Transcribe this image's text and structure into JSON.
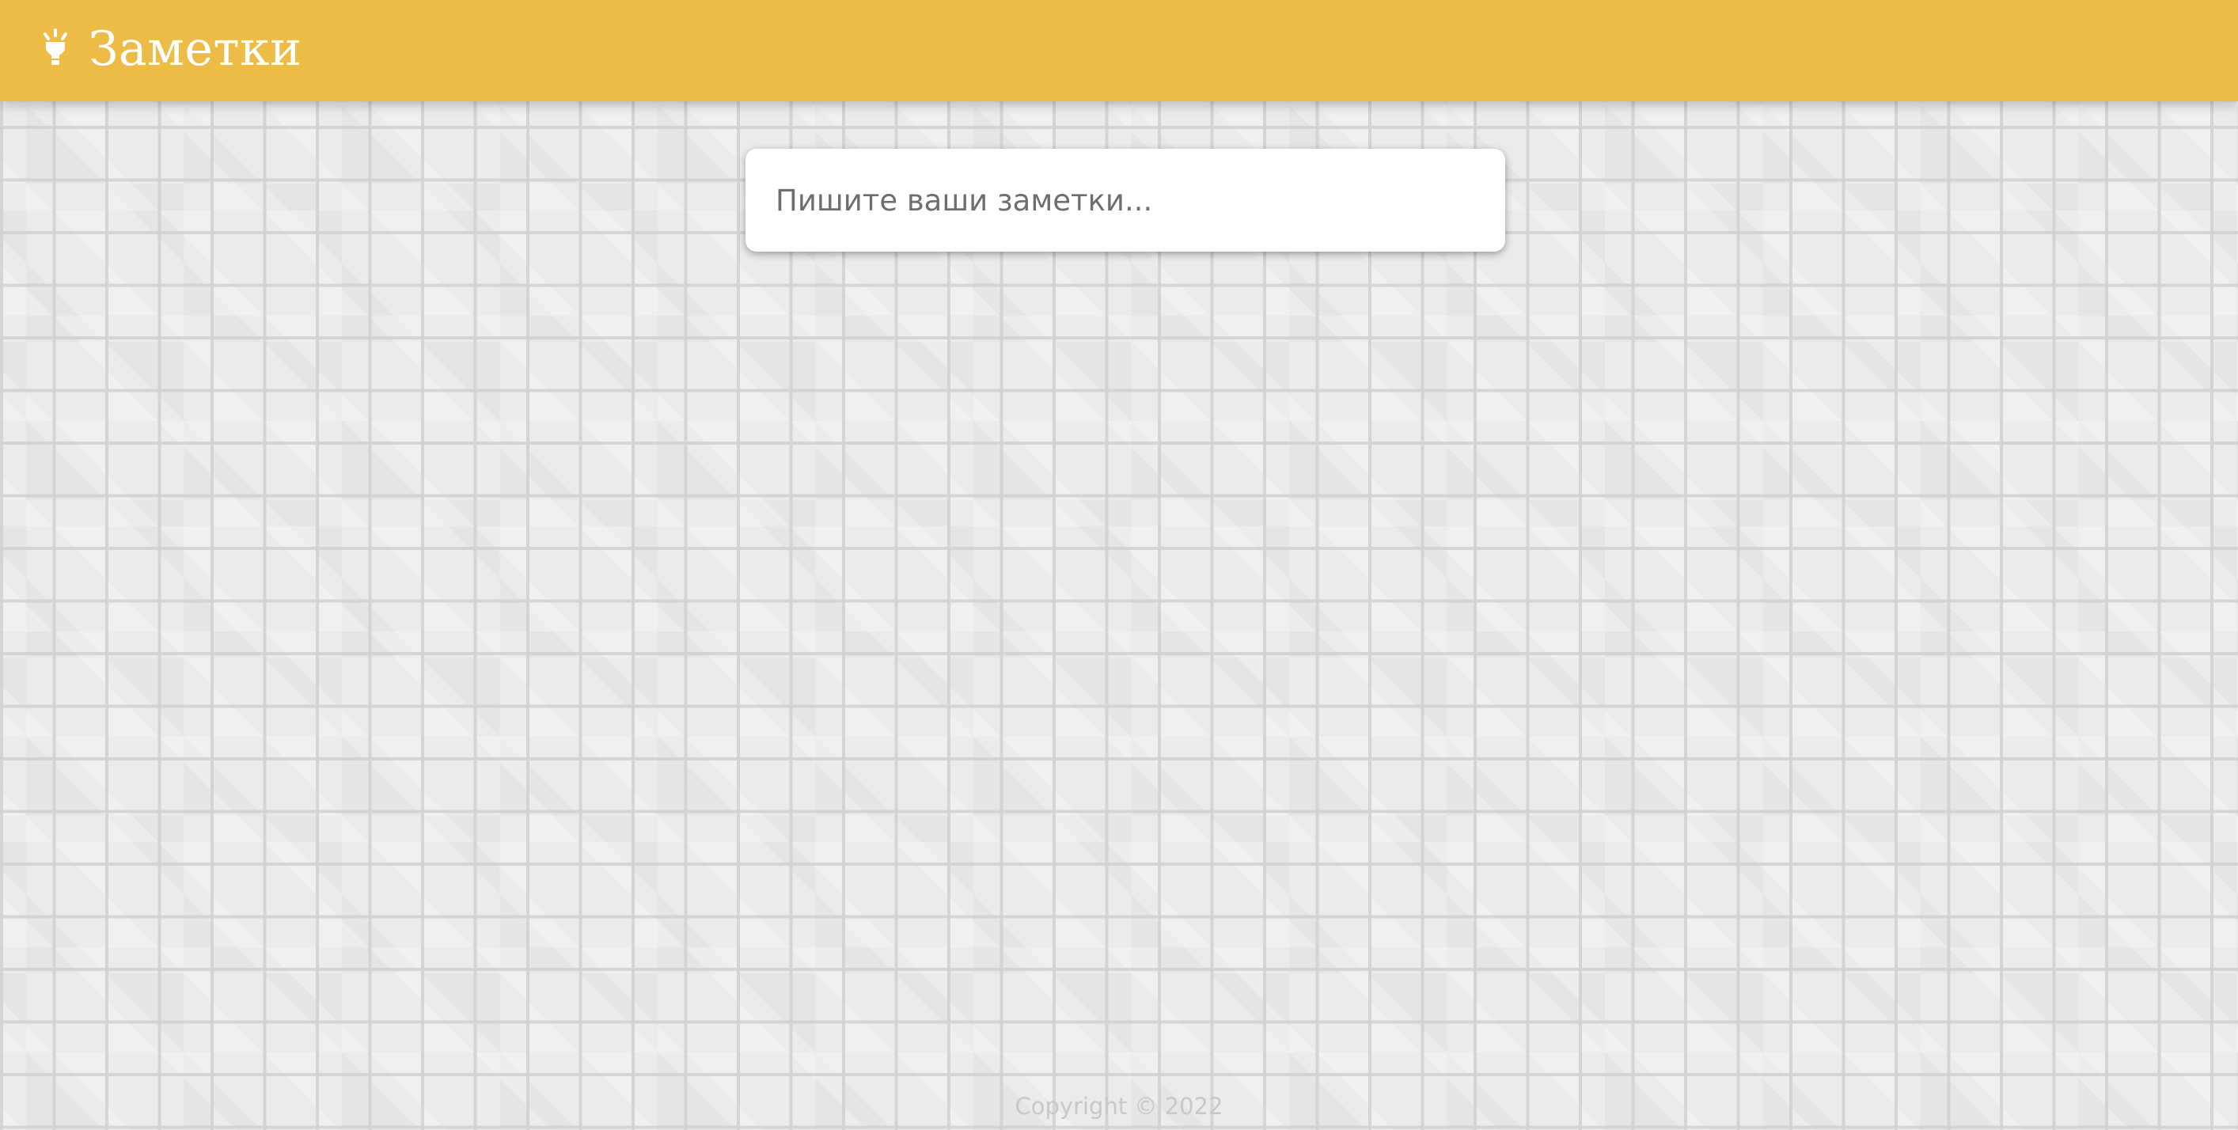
{
  "header": {
    "title": "Заметки",
    "logo_icon": "lightbulb-icon",
    "background_color": "#ecbc47"
  },
  "note_input": {
    "placeholder": "Пишите ваши заметки...",
    "value": ""
  },
  "footer": {
    "copyright": "Copyright © 2022"
  }
}
